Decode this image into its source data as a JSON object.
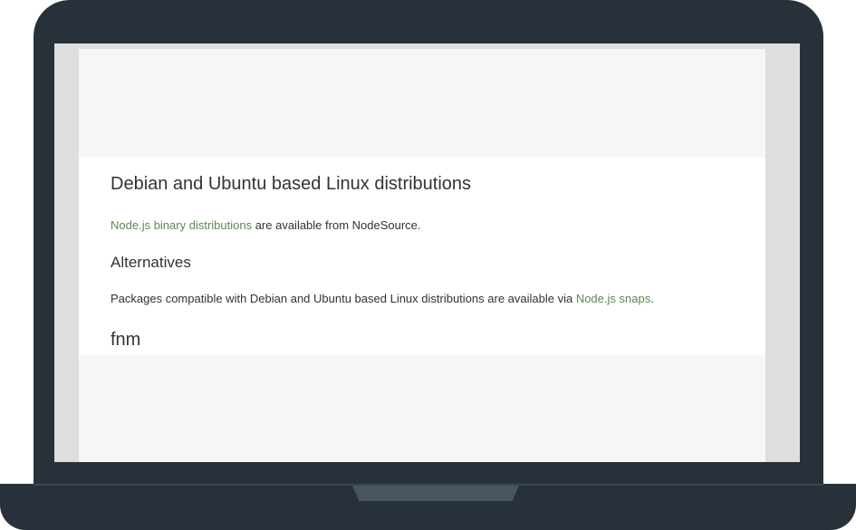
{
  "article": {
    "heading": "Debian and Ubuntu based Linux distributions",
    "intro_link": "Node.js binary distributions",
    "intro_rest": " are available from NodeSource.",
    "alt_heading": "Alternatives",
    "alt_text": "Packages compatible with Debian and Ubuntu based Linux distributions are available via ",
    "alt_link": "Node.js snaps",
    "alt_end": ".",
    "next_heading": "fnm"
  },
  "colors": {
    "link": "#5a8a50",
    "laptop_frame": "#28313a",
    "notch": "#465560",
    "page_background": "#f6f6f6"
  }
}
